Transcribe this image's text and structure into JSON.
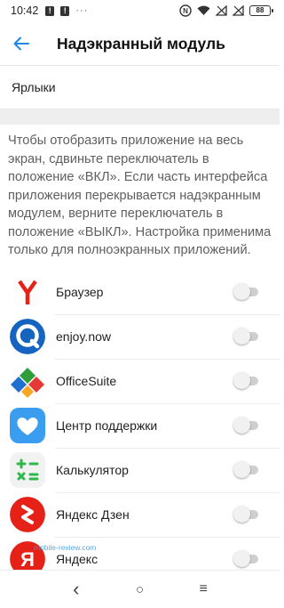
{
  "status_bar": {
    "time": "10:42",
    "notification_icons": [
      "alert-icon",
      "alert-icon",
      "more-dots-icon"
    ],
    "more_dots": "···",
    "battery_level": "88"
  },
  "app_bar": {
    "back_icon": "arrow-back-icon",
    "title": "Надэкранный модуль"
  },
  "shortcuts": {
    "label": "Ярлыки"
  },
  "description": "Чтобы отобразить приложение на весь экран, сдвиньте переключатель в положение «ВКЛ». Если часть интерфейса приложения перекрывается надэкранным модулем, верните переключатель в положение «ВЫКЛ». Настройка применима только для полноэкранных приложений.",
  "apps": [
    {
      "name": "Браузер",
      "icon": "yandex-browser-icon",
      "enabled": false
    },
    {
      "name": "enjoy.now",
      "icon": "enjoy-now-icon",
      "enabled": false
    },
    {
      "name": "OfficeSuite",
      "icon": "officesuite-icon",
      "enabled": false
    },
    {
      "name": "Центр поддержки",
      "icon": "support-center-icon",
      "enabled": false
    },
    {
      "name": "Калькулятор",
      "icon": "calculator-icon",
      "enabled": false
    },
    {
      "name": "Яндекс Дзен",
      "icon": "yandex-zen-icon",
      "enabled": false
    },
    {
      "name": "Яндекс",
      "icon": "yandex-icon",
      "enabled": false
    }
  ],
  "nav_bar": {
    "back": "‹",
    "home": "○",
    "recents": "≡"
  },
  "watermark": "mobile-review.com",
  "colors": {
    "accent": "#1e88e5",
    "yandex_red": "#e62117",
    "support_blue": "#3b9df0",
    "calc_green": "#2eb84a"
  }
}
